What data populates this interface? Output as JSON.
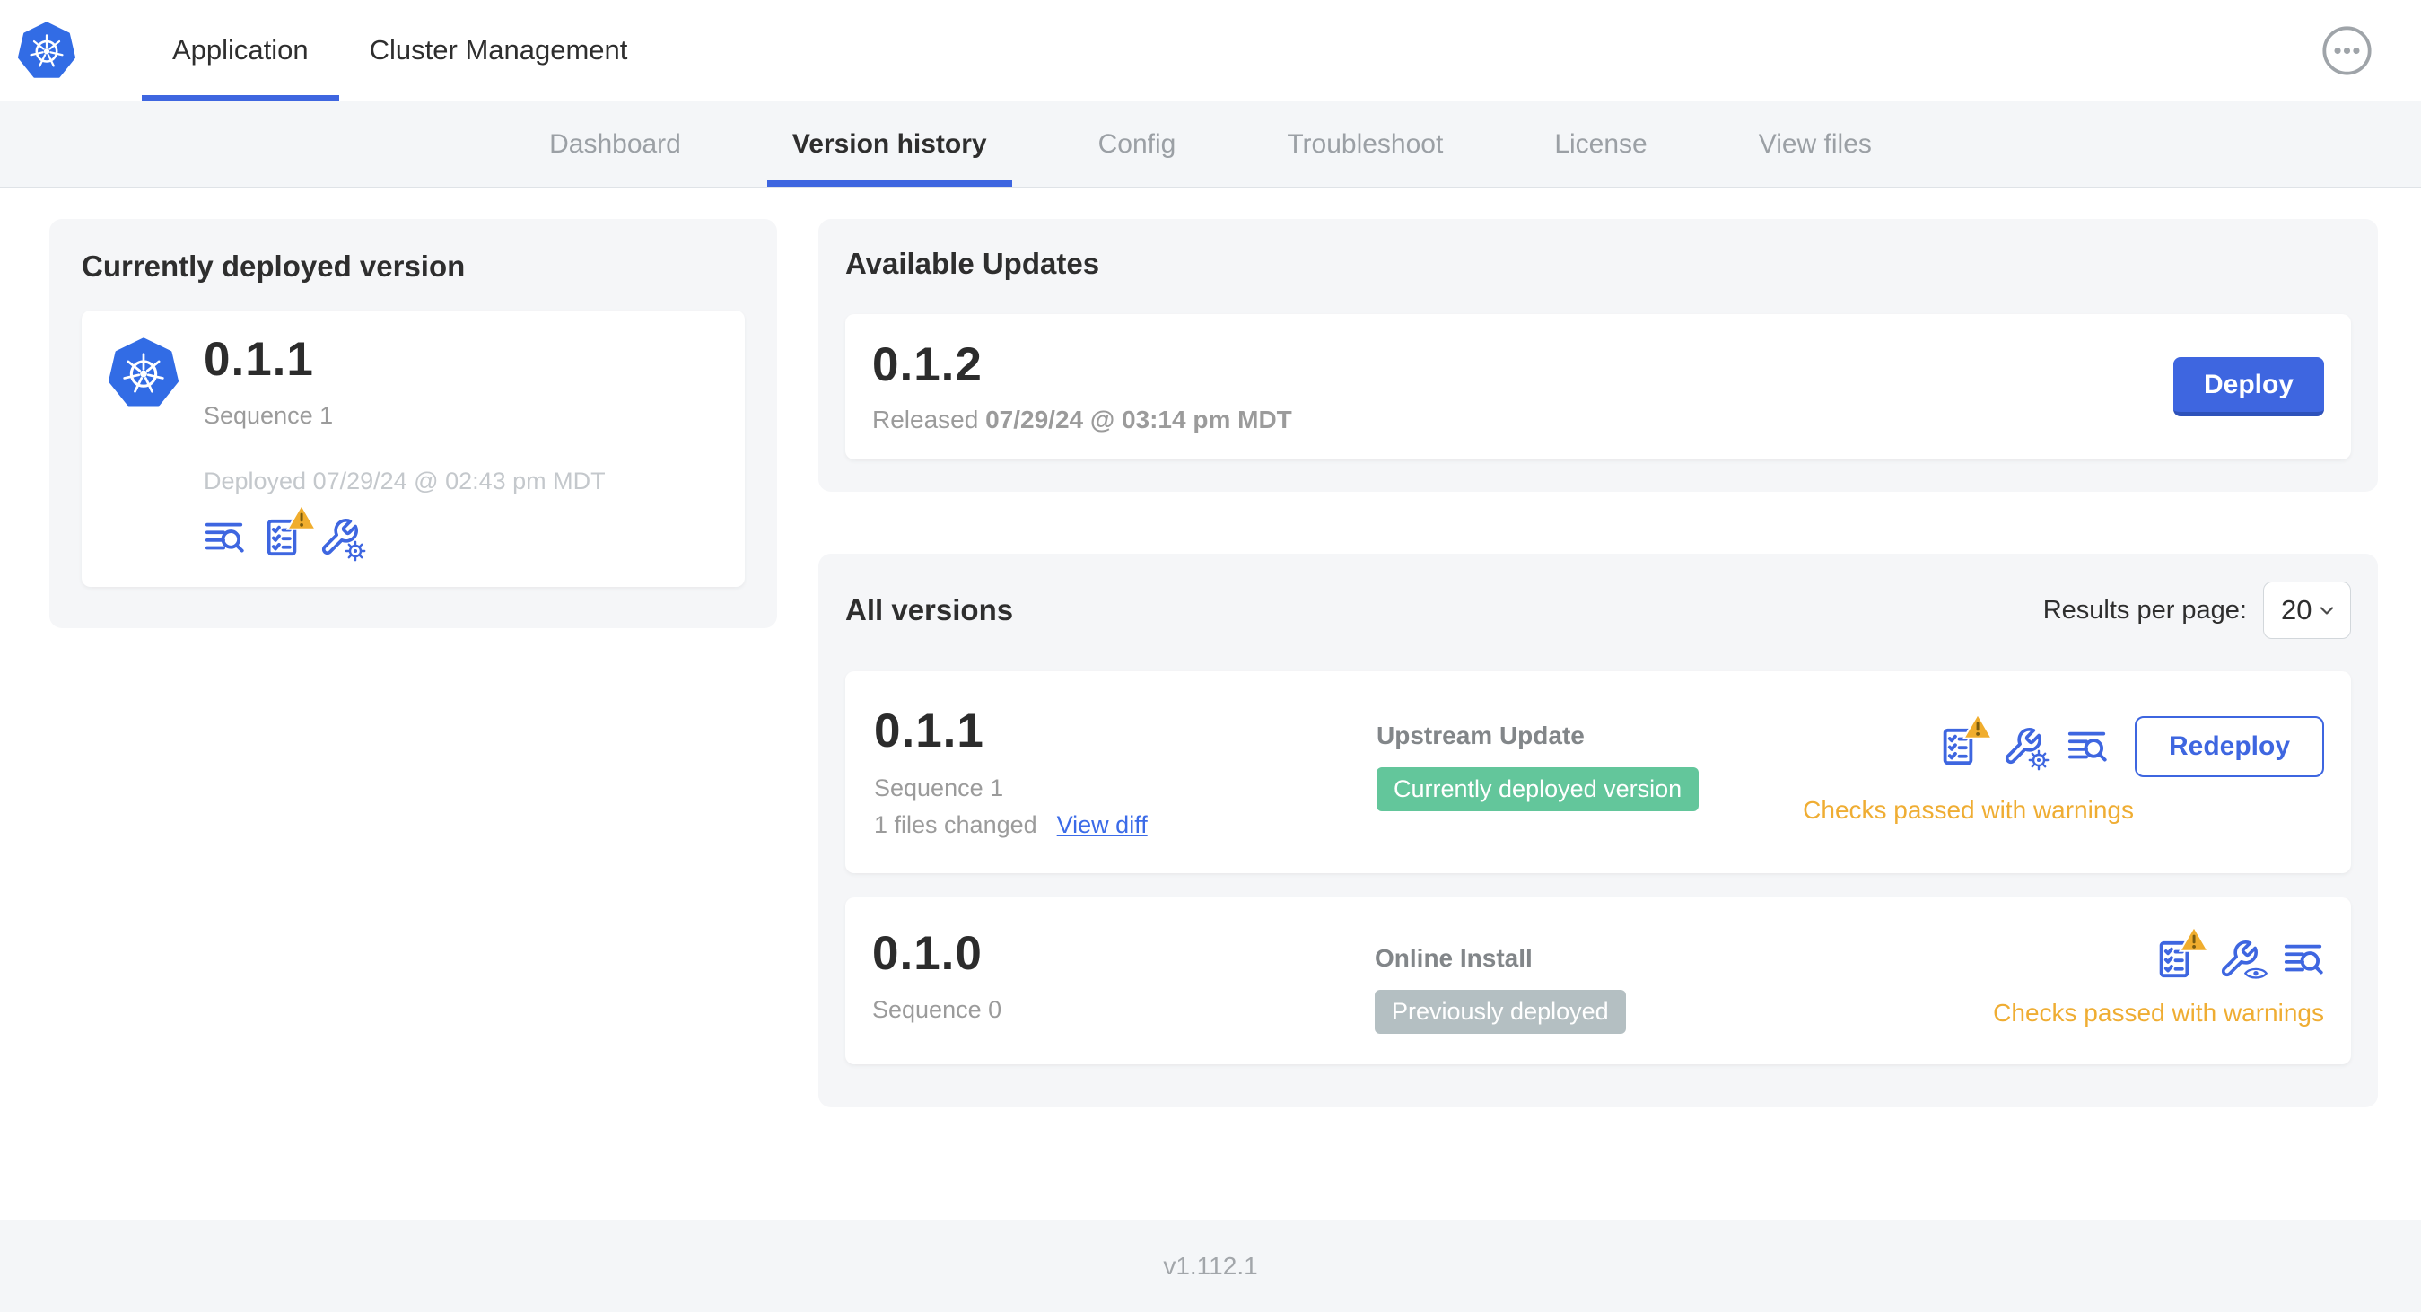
{
  "header": {
    "tabs": [
      {
        "label": "Application",
        "active": true
      },
      {
        "label": "Cluster Management",
        "active": false
      }
    ]
  },
  "subnav": {
    "items": [
      {
        "label": "Dashboard",
        "active": false
      },
      {
        "label": "Version history",
        "active": true
      },
      {
        "label": "Config",
        "active": false
      },
      {
        "label": "Troubleshoot",
        "active": false
      },
      {
        "label": "License",
        "active": false
      },
      {
        "label": "View files",
        "active": false
      }
    ]
  },
  "current_version_card": {
    "title": "Currently deployed version",
    "version": "0.1.1",
    "sequence": "Sequence 1",
    "deployed": "Deployed 07/29/24 @ 02:43 pm MDT"
  },
  "available_updates": {
    "title": "Available Updates",
    "version": "0.1.2",
    "released_label": "Released",
    "released_date": "07/29/24 @ 03:14 pm MDT",
    "deploy_label": "Deploy"
  },
  "all_versions": {
    "title": "All versions",
    "results_per_page_label": "Results per page:",
    "results_per_page_value": "20",
    "rows": [
      {
        "version": "0.1.1",
        "sequence": "Sequence 1",
        "files_changed": "1 files changed",
        "view_diff_label": "View diff",
        "source": "Upstream Update",
        "badge": "Currently deployed version",
        "badge_type": "green",
        "action_label": "Redeploy",
        "status": "Checks passed with warnings"
      },
      {
        "version": "0.1.0",
        "sequence": "Sequence 0",
        "source": "Online Install",
        "badge": "Previously deployed",
        "badge_type": "gray",
        "status": "Checks passed with warnings"
      }
    ]
  },
  "footer": {
    "version": "v1.112.1"
  },
  "colors": {
    "primary_blue": "#3E66E0",
    "kubernetes_blue": "#326CE5",
    "badge_green": "#63C69B",
    "badge_gray": "#B4BFC2",
    "warning_orange": "#EFAD33",
    "panel_gray": "#F5F6F8"
  }
}
